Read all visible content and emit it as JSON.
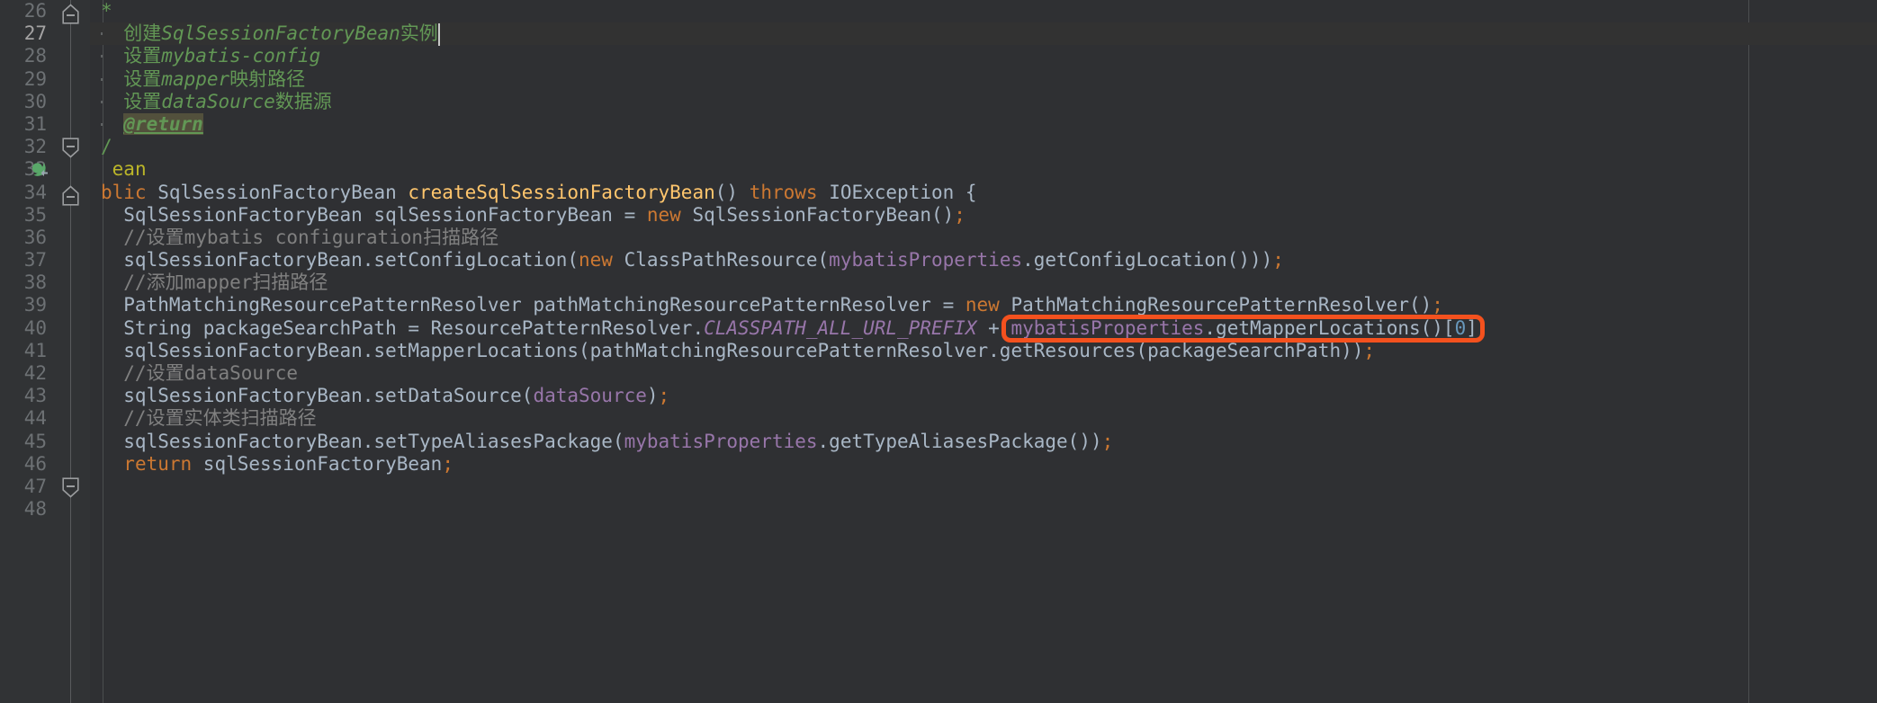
{
  "editor": {
    "theme": "darcula",
    "language": "java",
    "colors": {
      "background": "#2f3033",
      "gutter_background": "#313335",
      "default_text": "#a9b7c6",
      "keyword": "#cc7832",
      "javadoc": "#629755",
      "comment": "#808080",
      "annotation": "#bbb529",
      "method_declaration": "#ffc66d",
      "field": "#9876aa",
      "number": "#6897bb",
      "line_number": "#6d7174",
      "current_line_number": "#a4a3a3",
      "highlight_box": "#f4511e",
      "caret": "#c7c7c7"
    },
    "caret_line": 27,
    "first_visible_line": 26,
    "last_visible_line": 48
  },
  "highlight": {
    "label": "mybatisProperties.getMapperLocations()[0]",
    "line": 40,
    "color": "#f4511e"
  },
  "gutter": {
    "line_numbers": [
      26,
      27,
      28,
      29,
      30,
      31,
      32,
      33,
      34,
      35,
      36,
      37,
      38,
      39,
      40,
      41,
      42,
      43,
      44,
      45,
      46,
      47,
      48
    ],
    "markers": [
      {
        "line": 26,
        "type": "fold-collapse-start"
      },
      {
        "line": 32,
        "type": "fold-collapse-end"
      },
      {
        "line": 33,
        "type": "bean-run-icon"
      },
      {
        "line": 34,
        "type": "fold-collapse-start"
      },
      {
        "line": 47,
        "type": "fold-collapse-end"
      }
    ]
  },
  "lines": [
    {
      "n": 26,
      "tokens": [
        {
          "t": "*",
          "c": "doc"
        }
      ]
    },
    {
      "n": 27,
      "current": true,
      "tokens": [
        {
          "t": "  ",
          "c": "txt"
        },
        {
          "t": "创建",
          "c": "doc"
        },
        {
          "t": "SqlSessionFactoryBean",
          "c": "docitalic"
        },
        {
          "t": "实例",
          "c": "doc"
        }
      ]
    },
    {
      "n": 28,
      "tokens": [
        {
          "t": "  ",
          "c": "txt"
        },
        {
          "t": "设置",
          "c": "doc"
        },
        {
          "t": "mybatis-config",
          "c": "docitalic"
        }
      ]
    },
    {
      "n": 29,
      "tokens": [
        {
          "t": "  ",
          "c": "txt"
        },
        {
          "t": "设置",
          "c": "doc"
        },
        {
          "t": "mapper",
          "c": "docitalic"
        },
        {
          "t": "映射路径",
          "c": "doc"
        }
      ]
    },
    {
      "n": 30,
      "tokens": [
        {
          "t": "  ",
          "c": "txt"
        },
        {
          "t": "设置",
          "c": "doc"
        },
        {
          "t": "dataSource",
          "c": "docitalic"
        },
        {
          "t": "数据源",
          "c": "doc"
        }
      ]
    },
    {
      "n": 31,
      "tokens": [
        {
          "t": "  ",
          "c": "txt"
        },
        {
          "t": "@return",
          "c": "doctag"
        }
      ]
    },
    {
      "n": 32,
      "tokens": [
        {
          "t": "/",
          "c": "doc"
        }
      ]
    },
    {
      "n": 33,
      "tokens": [
        {
          "t": " ",
          "c": "txt"
        },
        {
          "t": "ean",
          "c": "ann"
        }
      ]
    },
    {
      "n": 34,
      "tokens": [
        {
          "t": "blic",
          "c": "kw"
        },
        {
          "t": " SqlSessionFactoryBean ",
          "c": "txt"
        },
        {
          "t": "createSqlSessionFactoryBean",
          "c": "fn"
        },
        {
          "t": "() ",
          "c": "txt"
        },
        {
          "t": "throws",
          "c": "kw"
        },
        {
          "t": " IOException {",
          "c": "txt"
        }
      ]
    },
    {
      "n": 35,
      "tokens": [
        {
          "t": "  SqlSessionFactoryBean sqlSessionFactoryBean = ",
          "c": "txt"
        },
        {
          "t": "new",
          "c": "kw"
        },
        {
          "t": " SqlSessionFactoryBean()",
          "c": "txt"
        },
        {
          "t": ";",
          "c": "sem"
        }
      ]
    },
    {
      "n": 36,
      "tokens": [
        {
          "t": "  //设置mybatis configuration扫描路径",
          "c": "cmt"
        }
      ]
    },
    {
      "n": 37,
      "tokens": [
        {
          "t": "  sqlSessionFactoryBean.setConfigLocation(",
          "c": "txt"
        },
        {
          "t": "new",
          "c": "kw"
        },
        {
          "t": " ClassPathResource(",
          "c": "txt"
        },
        {
          "t": "mybatisProperties",
          "c": "fld"
        },
        {
          "t": ".getConfigLocation()))",
          "c": "txt"
        },
        {
          "t": ";",
          "c": "sem"
        }
      ]
    },
    {
      "n": 38,
      "tokens": [
        {
          "t": "  //添加mapper扫描路径",
          "c": "cmt"
        }
      ]
    },
    {
      "n": 39,
      "tokens": [
        {
          "t": "  PathMatchingResourcePatternResolver pathMatchingResourcePatternResolver = ",
          "c": "txt"
        },
        {
          "t": "new",
          "c": "kw"
        },
        {
          "t": " PathMatchingResourcePatternResolver()",
          "c": "txt"
        },
        {
          "t": ";",
          "c": "sem"
        }
      ]
    },
    {
      "n": 40,
      "tokens": [
        {
          "t": "  String packageSearchPath = ResourcePatternResolver.",
          "c": "txt"
        },
        {
          "t": "CLASSPATH_ALL_URL_PREFIX",
          "c": "const"
        },
        {
          "t": " + ",
          "c": "txt"
        },
        {
          "t": "mybatisProperties",
          "c": "fld"
        },
        {
          "t": ".getMapperLocations()[",
          "c": "txt"
        },
        {
          "t": "0",
          "c": "num"
        },
        {
          "t": "]",
          "c": "txt"
        },
        {
          "t": ";",
          "c": "sem"
        }
      ]
    },
    {
      "n": 41,
      "tokens": [
        {
          "t": "  sqlSessionFactoryBean.setMapperLocations(pathMatchingResourcePatternResolver.getResources(packageSearchPath))",
          "c": "txt"
        },
        {
          "t": ";",
          "c": "sem"
        }
      ]
    },
    {
      "n": 42,
      "tokens": [
        {
          "t": "  //设置dataSource",
          "c": "cmt"
        }
      ]
    },
    {
      "n": 43,
      "tokens": [
        {
          "t": "  sqlSessionFactoryBean.setDataSource(",
          "c": "txt"
        },
        {
          "t": "dataSource",
          "c": "fld"
        },
        {
          "t": ")",
          "c": "txt"
        },
        {
          "t": ";",
          "c": "sem"
        }
      ]
    },
    {
      "n": 44,
      "tokens": [
        {
          "t": "  //设置实体类扫描路径",
          "c": "cmt"
        }
      ]
    },
    {
      "n": 45,
      "tokens": [
        {
          "t": "  sqlSessionFactoryBean.setTypeAliasesPackage(",
          "c": "txt"
        },
        {
          "t": "mybatisProperties",
          "c": "fld"
        },
        {
          "t": ".getTypeAliasesPackage())",
          "c": "txt"
        },
        {
          "t": ";",
          "c": "sem"
        }
      ]
    },
    {
      "n": 46,
      "tokens": [
        {
          "t": "  ",
          "c": "txt"
        },
        {
          "t": "return",
          "c": "kw"
        },
        {
          "t": " sqlSessionFactoryBean",
          "c": "txt"
        },
        {
          "t": ";",
          "c": "sem"
        }
      ]
    },
    {
      "n": 47,
      "tokens": []
    },
    {
      "n": 48,
      "tokens": []
    }
  ]
}
